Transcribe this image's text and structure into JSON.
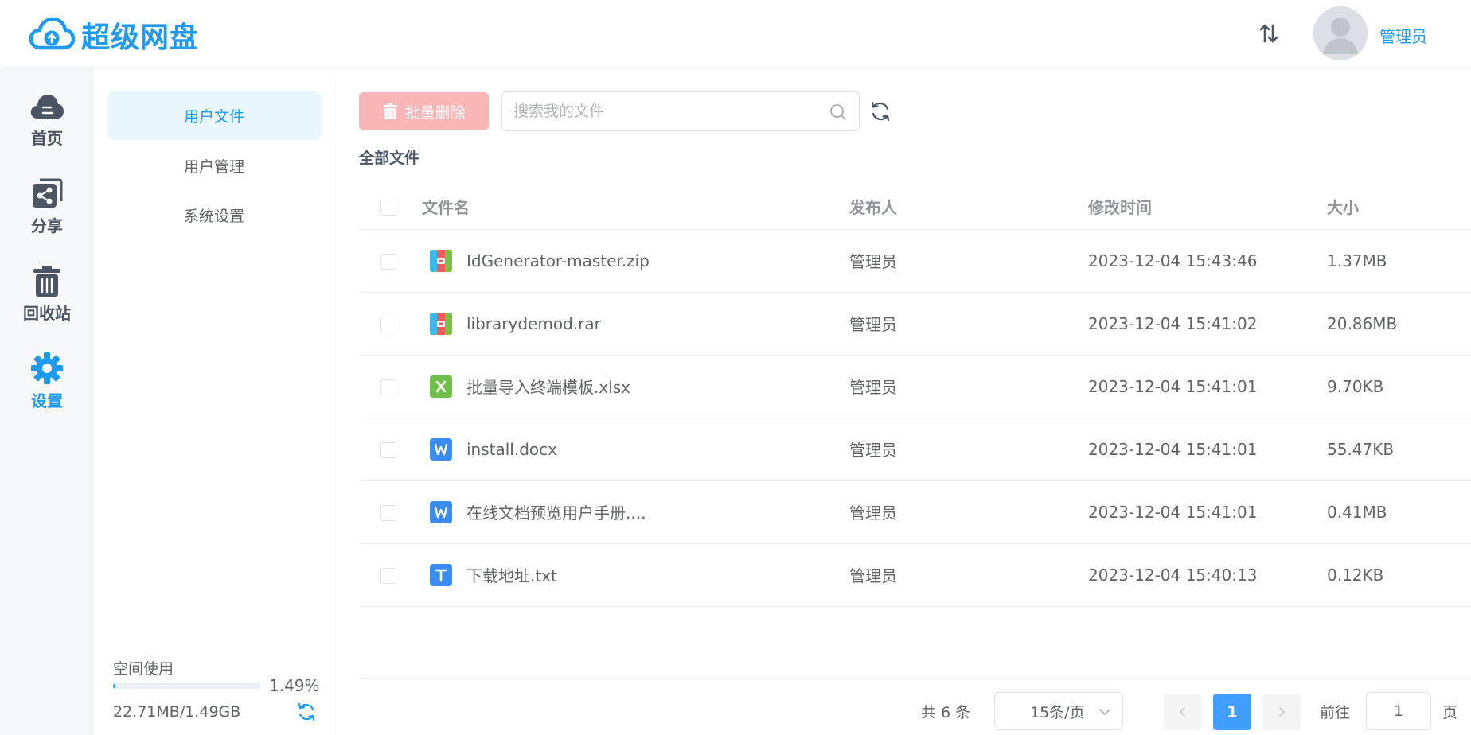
{
  "app": {
    "title": "超级网盘"
  },
  "header": {
    "user_name": "管理员"
  },
  "rail": [
    {
      "label": "首页",
      "icon": "cloud-icon"
    },
    {
      "label": "分享",
      "icon": "share-icon"
    },
    {
      "label": "回收站",
      "icon": "trash-icon"
    },
    {
      "label": "设置",
      "icon": "gear-icon"
    }
  ],
  "submenu": [
    {
      "label": "用户文件",
      "active": true
    },
    {
      "label": "用户管理"
    },
    {
      "label": "系统设置"
    }
  ],
  "space": {
    "label": "空间使用",
    "percent_text": "1.49%",
    "percent": 1.49,
    "usage": "22.71MB/1.49GB"
  },
  "toolbar": {
    "delete_label": "批量删除",
    "search_placeholder": "搜索我的文件"
  },
  "breadcrumb": "全部文件",
  "table": {
    "headers": {
      "name": "文件名",
      "owner": "发布人",
      "modified": "修改时间",
      "size": "大小"
    },
    "rows": [
      {
        "name": "IdGenerator-master.zip",
        "type": "archive",
        "owner": "管理员",
        "modified": "2023-12-04 15:43:46",
        "size": "1.37MB"
      },
      {
        "name": "librarydemod.rar",
        "type": "archive",
        "owner": "管理员",
        "modified": "2023-12-04 15:41:02",
        "size": "20.86MB"
      },
      {
        "name": "批量导入终端模板.xlsx",
        "type": "excel",
        "owner": "管理员",
        "modified": "2023-12-04 15:41:01",
        "size": "9.70KB"
      },
      {
        "name": "install.docx",
        "type": "word",
        "owner": "管理员",
        "modified": "2023-12-04 15:41:01",
        "size": "55.47KB"
      },
      {
        "name": "在线文档预览用户手册....",
        "type": "word",
        "owner": "管理员",
        "modified": "2023-12-04 15:41:01",
        "size": "0.41MB"
      },
      {
        "name": "下载地址.txt",
        "type": "text",
        "owner": "管理员",
        "modified": "2023-12-04 15:40:13",
        "size": "0.12KB"
      }
    ]
  },
  "pagination": {
    "total": "共 6 条",
    "page_size": "15条/页",
    "current": "1",
    "goto_label": "前往",
    "goto_value": "1",
    "goto_unit": "页"
  },
  "colors": {
    "accent": "#1e9af0",
    "danger_light": "#fab6b6",
    "page_active": "#409eff"
  }
}
